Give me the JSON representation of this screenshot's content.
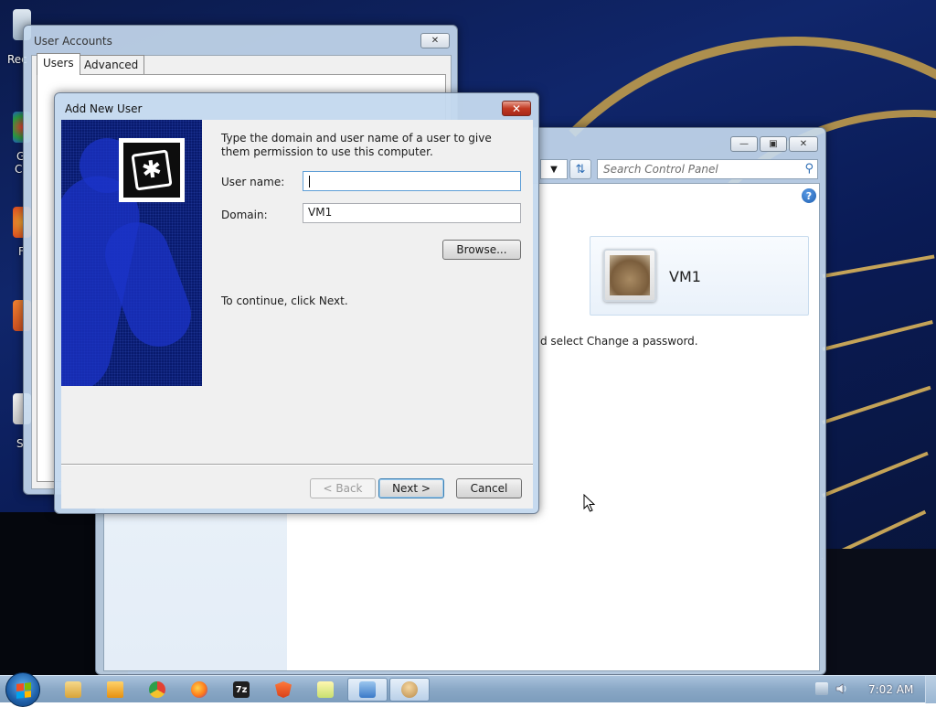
{
  "desktop": {
    "icon_labels": [
      "Rec",
      "G",
      "C",
      "F",
      "S"
    ]
  },
  "control_panel": {
    "search_placeholder": "Search Control Panel",
    "user_name": "VM1",
    "text_fragment": "d select Change a password."
  },
  "user_accounts": {
    "title": "User Accounts",
    "tabs": [
      {
        "label": "Users"
      },
      {
        "label": "Advanced"
      }
    ],
    "close_glyph": "✕"
  },
  "add_user_dialog": {
    "title": "Add New User",
    "close_glyph": "✕",
    "instructions": "Type the domain and user name of a user to give them permission to use this computer.",
    "username_label": "User name:",
    "username_value": "",
    "domain_label": "Domain:",
    "domain_value": "VM1",
    "browse_label": "Browse...",
    "continue_text": "To continue, click Next.",
    "back_label": "< Back",
    "next_label": "Next >",
    "cancel_label": "Cancel"
  },
  "taskbar": {
    "clock": "7:02 AM",
    "items": [
      {
        "name": "file-explorer",
        "color": "#e8b84a"
      },
      {
        "name": "media-player",
        "color": "#f0a020"
      },
      {
        "name": "chrome",
        "color": "#3a8ee6"
      },
      {
        "name": "firefox",
        "color": "#e8702a"
      },
      {
        "name": "7zip",
        "color": "#222222",
        "label": "7z"
      },
      {
        "name": "brave",
        "color": "#e0502a"
      },
      {
        "name": "notepad",
        "color": "#9ed05a"
      },
      {
        "name": "control-panel",
        "color": "#4a8ad0"
      },
      {
        "name": "user-accounts",
        "color": "#c8a060"
      }
    ]
  }
}
